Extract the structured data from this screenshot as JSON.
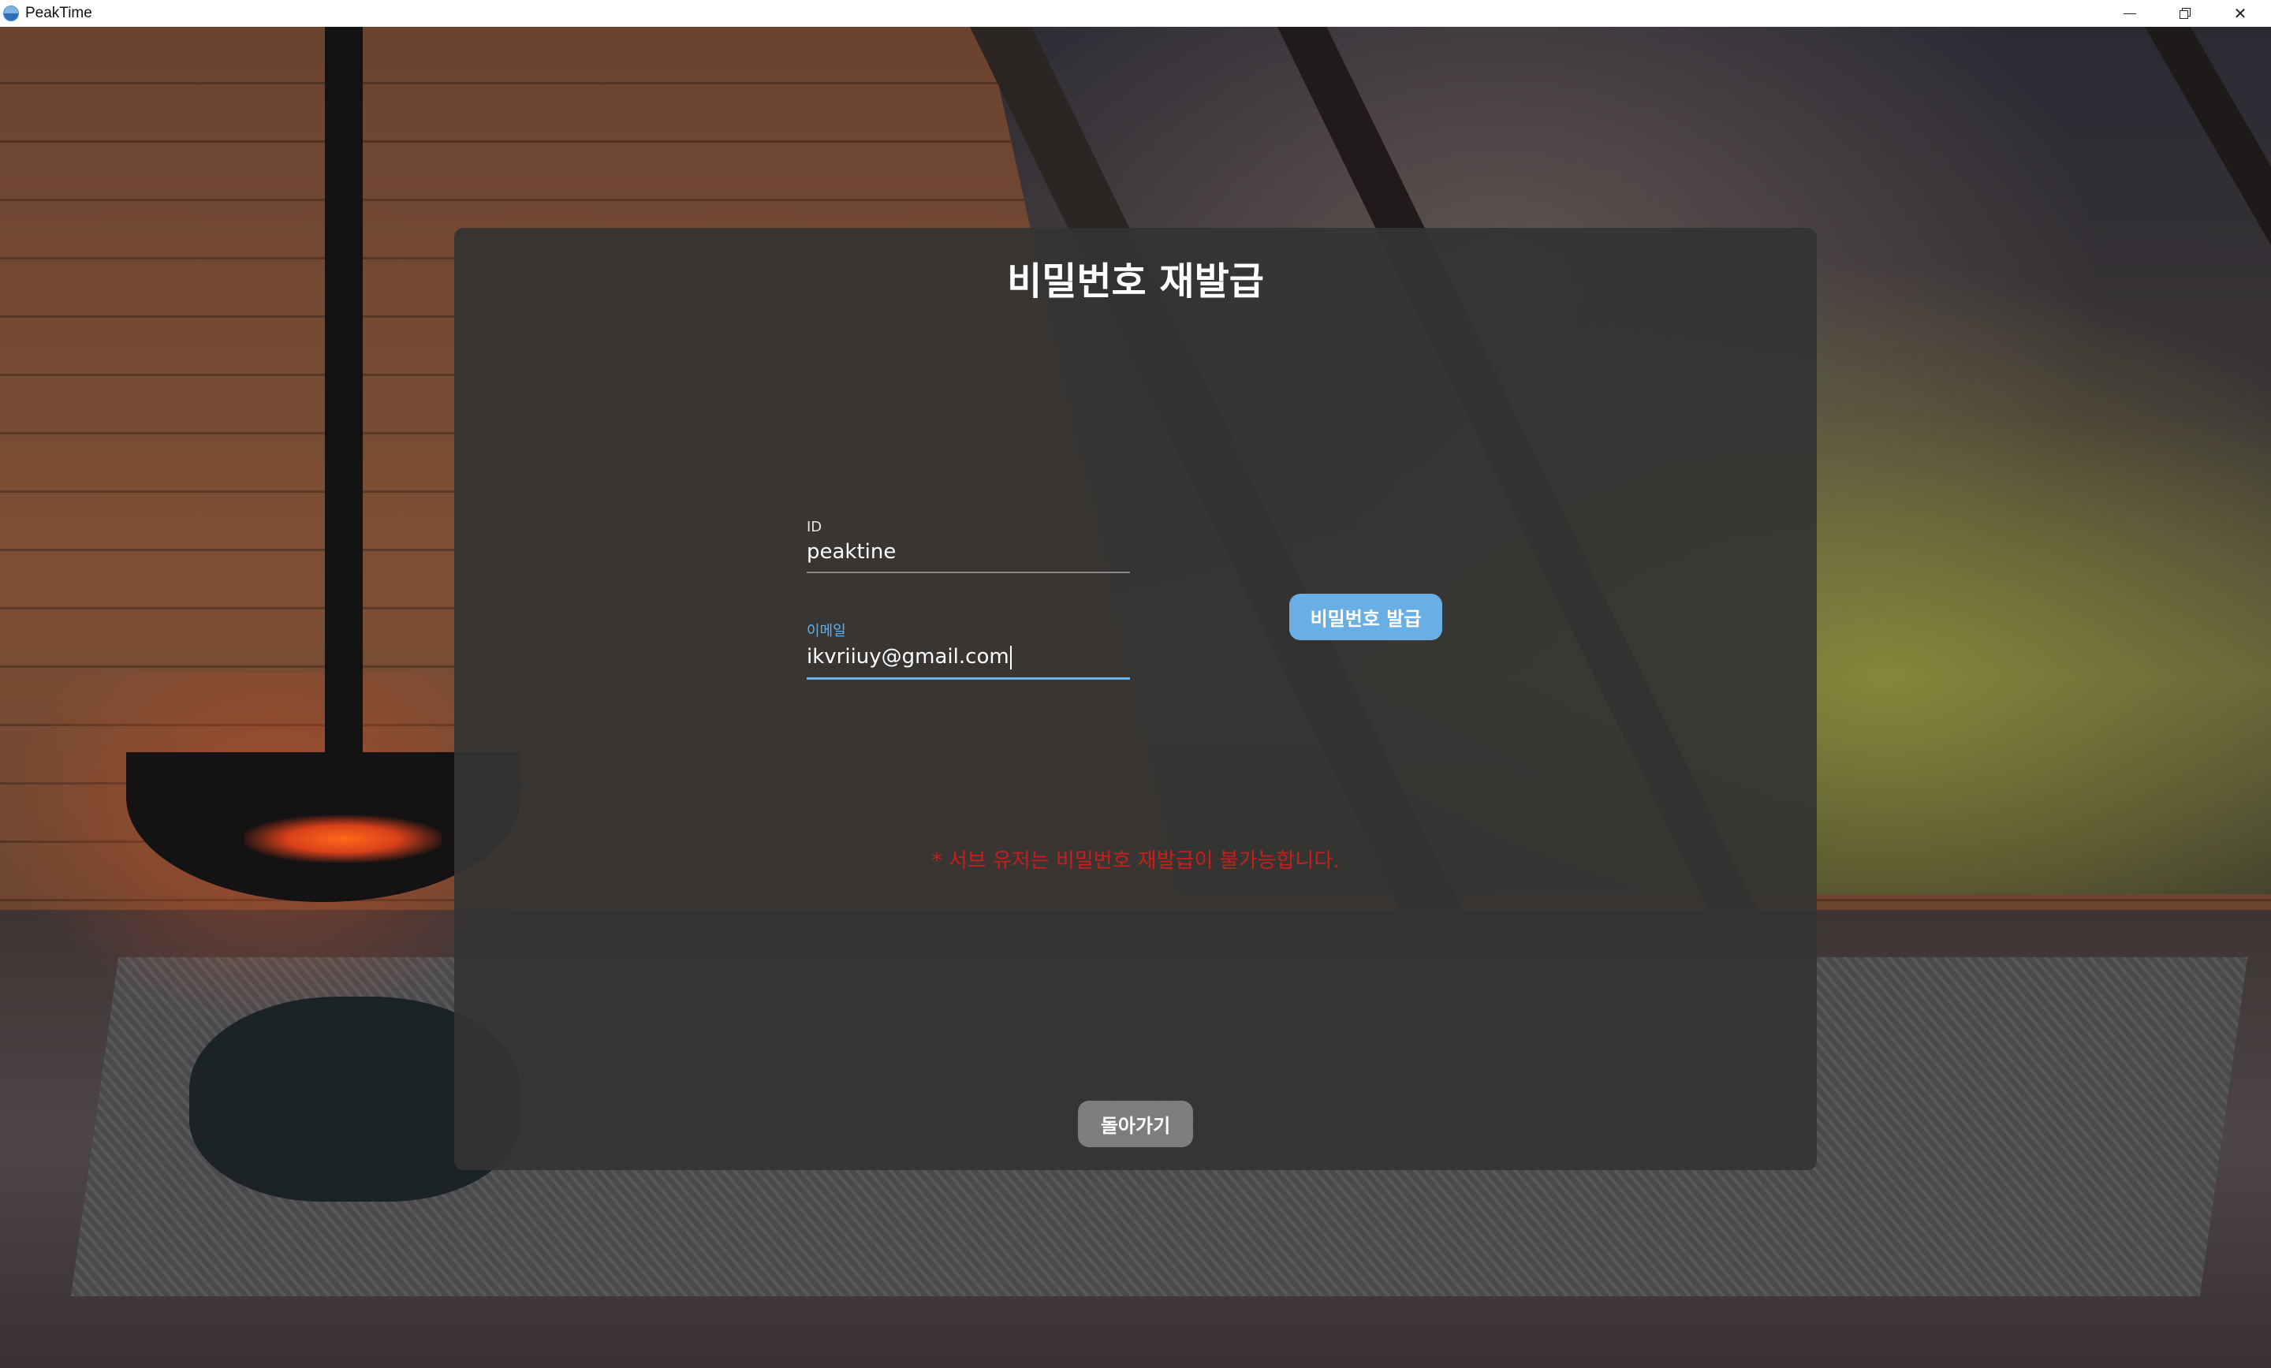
{
  "window": {
    "title": "PeakTime",
    "icons": {
      "app": "peaktime-logo-icon",
      "minimize": "minimize-icon",
      "maximize": "restore-icon",
      "close": "close-icon"
    },
    "close_glyph": "✕"
  },
  "dialog": {
    "title": "비밀번호 재발급",
    "id_field": {
      "label": "ID",
      "value": "peaktine"
    },
    "email_field": {
      "label": "이메일",
      "value": "ikvriiuy@gmail.com",
      "focused": true
    },
    "issue_button_label": "비밀번호 발급",
    "notice": "* 서브 유저는 비밀번호 재발급이 불가능합니다.",
    "back_button_label": "돌아가기"
  },
  "colors": {
    "accent": "#6aaee6",
    "panel": "#343434",
    "error": "#c81e1e",
    "back_button": "#7d7d7d"
  }
}
